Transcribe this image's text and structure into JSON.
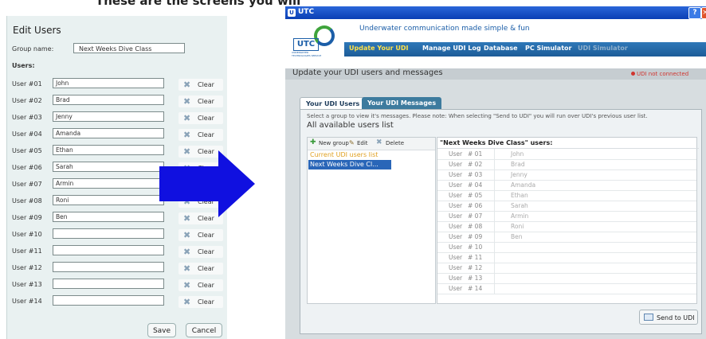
{
  "caption": "These are the screens you will",
  "edit_users": {
    "title": "Edit Users",
    "group_label": "Group name:",
    "group_value": "Next Weeks Dive Class",
    "users_label": "Users:",
    "rows": [
      {
        "label": "User #01",
        "value": "John"
      },
      {
        "label": "User #02",
        "value": "Brad"
      },
      {
        "label": "User #03",
        "value": "Jenny"
      },
      {
        "label": "User #04",
        "value": "Amanda"
      },
      {
        "label": "User #05",
        "value": "Ethan"
      },
      {
        "label": "User #06",
        "value": "Sarah"
      },
      {
        "label": "User #07",
        "value": "Armin"
      },
      {
        "label": "User #08",
        "value": "Roni"
      },
      {
        "label": "User #09",
        "value": "Ben"
      },
      {
        "label": "User #10",
        "value": ""
      },
      {
        "label": "User #11",
        "value": ""
      },
      {
        "label": "User #12",
        "value": ""
      },
      {
        "label": "User #13",
        "value": ""
      },
      {
        "label": "User #14",
        "value": ""
      }
    ],
    "clear_label": "Clear",
    "save_label": "Save",
    "cancel_label": "Cancel"
  },
  "utc": {
    "window_title": "UTC",
    "help_label": "?",
    "logo_text": "UTC",
    "logo_subtext": "UNDERWATER TECHNOLOGIES SERVICE",
    "tagline": "Underwater communication made simple & fun",
    "nav": [
      {
        "label": "Update Your UDI",
        "state": "active"
      },
      {
        "label": "Manage UDI Log",
        "state": "normal"
      },
      {
        "label": "Database",
        "state": "normal"
      },
      {
        "label": "PC Simulator",
        "state": "normal"
      },
      {
        "label": "UDI Simulator",
        "state": "dim"
      }
    ],
    "section_title": "Update your UDI users and messages",
    "connection_status": "UDI not connected",
    "status_color": "#d0352f",
    "tabs": [
      {
        "label": "Your UDI Users",
        "active": true
      },
      {
        "label": "Your UDI Messages",
        "active": false
      }
    ],
    "instructions": "Select a group to view it's messages. Please note: When selecting \"Send to UDI\" you will run over UDI's previous user list.",
    "list_title": "All available users list",
    "toolbar": {
      "new_group": "New group",
      "edit": "Edit",
      "delete": "Delete"
    },
    "groups": [
      {
        "label": "Current UDI users list",
        "selected": false
      },
      {
        "label": "Next Weeks Dive Cl...",
        "selected": true
      }
    ],
    "users_header": "\"Next Weeks Dive Class\" users:",
    "user_type": "User",
    "users": [
      {
        "num": "# 01",
        "name": "John"
      },
      {
        "num": "# 02",
        "name": "Brad"
      },
      {
        "num": "# 03",
        "name": "Jenny"
      },
      {
        "num": "# 04",
        "name": "Amanda"
      },
      {
        "num": "# 05",
        "name": "Ethan"
      },
      {
        "num": "# 06",
        "name": "Sarah"
      },
      {
        "num": "# 07",
        "name": "Armin"
      },
      {
        "num": "# 08",
        "name": "Roni"
      },
      {
        "num": "# 09",
        "name": "Ben"
      },
      {
        "num": "# 10",
        "name": ""
      },
      {
        "num": "# 11",
        "name": ""
      },
      {
        "num": "# 12",
        "name": ""
      },
      {
        "num": "# 13",
        "name": ""
      },
      {
        "num": "# 14",
        "name": ""
      }
    ],
    "send_label": "Send to UDI"
  },
  "colors": {
    "arrow": "#1010e0",
    "nav_active": "#ffe24a",
    "selection": "#2966b8"
  }
}
